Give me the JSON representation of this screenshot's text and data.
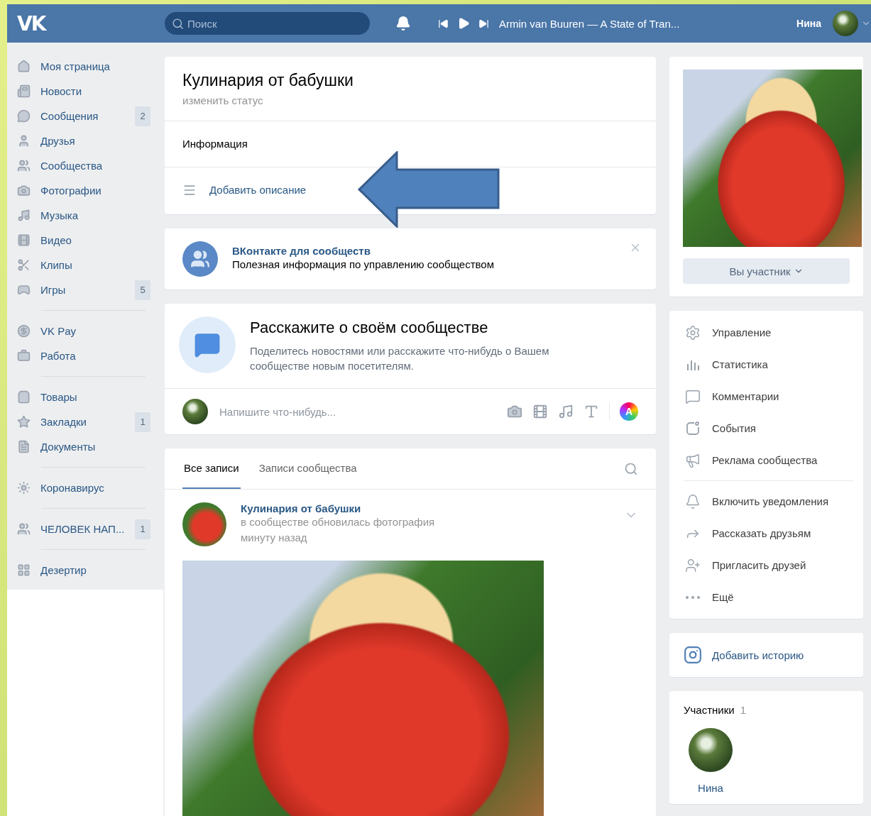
{
  "header": {
    "logo": "VK",
    "search": {
      "placeholder": "Поиск"
    },
    "track": "Armin van Buuren — A State of Tran...",
    "user": "Нина"
  },
  "sidebar": {
    "groups": [
      {
        "items": [
          {
            "label": "Моя страница"
          },
          {
            "label": "Новости"
          },
          {
            "label": "Сообщения",
            "badge": "2"
          },
          {
            "label": "Друзья"
          },
          {
            "label": "Сообщества"
          },
          {
            "label": "Фотографии"
          },
          {
            "label": "Музыка"
          },
          {
            "label": "Видео"
          },
          {
            "label": "Клипы"
          },
          {
            "label": "Игры",
            "badge": "5"
          }
        ]
      },
      {
        "items": [
          {
            "label": "VK Pay"
          },
          {
            "label": "Работа"
          }
        ]
      },
      {
        "items": [
          {
            "label": "Товары"
          },
          {
            "label": "Закладки",
            "badge": "1"
          },
          {
            "label": "Документы"
          }
        ]
      },
      {
        "items": [
          {
            "label": "Коронавирус"
          }
        ]
      },
      {
        "items": [
          {
            "label": "ЧЕЛОВЕК НАП...",
            "badge": "1"
          }
        ]
      },
      {
        "items": [
          {
            "label": "Дезертир"
          }
        ]
      }
    ]
  },
  "community": {
    "name": "Кулинария от бабушки",
    "status_link": "изменить статус",
    "info_heading": "Информация",
    "add_description": "Добавить описание"
  },
  "promo": {
    "title": "ВКонтакте для сообществ",
    "text": "Полезная информация по управлению сообществом"
  },
  "tell": {
    "title": "Расскажите о своём сообществе",
    "text": "Поделитесь новостями или расскажите что-нибудь о Вашем сообществе новым посетителям.",
    "composer_placeholder": "Напишите что-нибудь...",
    "mood_badge": "A"
  },
  "wall": {
    "tabs": [
      {
        "label": "Все записи",
        "selected": true
      },
      {
        "label": "Записи сообщества",
        "selected": false
      }
    ],
    "post": {
      "author": "Кулинария от бабушки",
      "action": "в сообществе обновилась фотография",
      "time": "минуту назад"
    }
  },
  "right": {
    "member_button": "Вы участник",
    "action_groups": [
      [
        {
          "label": "Управление"
        },
        {
          "label": "Статистика"
        },
        {
          "label": "Комментарии"
        },
        {
          "label": "События"
        },
        {
          "label": "Реклама сообщества"
        }
      ],
      [
        {
          "label": "Включить уведомления"
        },
        {
          "label": "Рассказать друзьям"
        },
        {
          "label": "Пригласить друзей"
        },
        {
          "label": "Ещё"
        }
      ]
    ],
    "story": "Добавить историю",
    "members": {
      "title": "Участники",
      "count": "1",
      "list": [
        {
          "name": "Нина"
        }
      ]
    }
  }
}
